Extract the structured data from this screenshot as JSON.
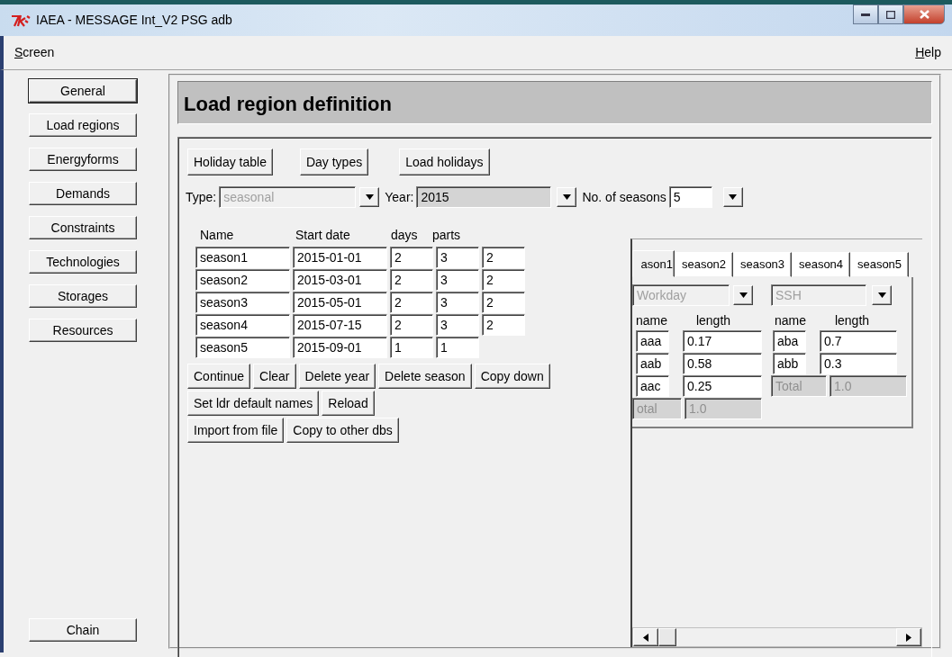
{
  "window": {
    "title": "IAEA - MESSAGE Int_V2 PSG adb"
  },
  "menu": [
    {
      "label": "Screen"
    },
    {
      "label": "Help"
    }
  ],
  "sidebar": {
    "items": [
      {
        "label": "General",
        "focused": true
      },
      {
        "label": "Load regions",
        "focused": false
      },
      {
        "label": "Energyforms",
        "focused": false
      },
      {
        "label": "Demands",
        "focused": false
      },
      {
        "label": "Constraints",
        "focused": false
      },
      {
        "label": "Technologies",
        "focused": false
      },
      {
        "label": "Storages",
        "focused": false
      },
      {
        "label": "Resources",
        "focused": false
      }
    ],
    "bottom_button": {
      "label": "Chain"
    }
  },
  "header": {
    "title": "Load region definition"
  },
  "top_buttons": [
    "Holiday table",
    "Day types",
    "Load holidays"
  ],
  "selectors": [
    {
      "label": "Type:",
      "value": "seasonal",
      "disabled": true,
      "readonly": false
    },
    {
      "label": "Year:",
      "value": "2015",
      "disabled": false,
      "readonly": true
    },
    {
      "label": "No. of seasons",
      "value": "5",
      "disabled": false,
      "readonly": false
    }
  ],
  "seasons_table": {
    "columns": [
      "Name",
      "Start date",
      "days",
      "parts"
    ],
    "rows": [
      [
        "season1",
        "2015-01-01",
        "2",
        "3",
        "2"
      ],
      [
        "season2",
        "2015-03-01",
        "2",
        "3",
        "2"
      ],
      [
        "season3",
        "2015-05-01",
        "2",
        "3",
        "2"
      ],
      [
        "season4",
        "2015-07-15",
        "2",
        "3",
        "2"
      ],
      [
        "season5",
        "2015-09-01",
        "1",
        "1"
      ]
    ]
  },
  "action_buttons": [
    [
      "Continue",
      "Clear",
      "Delete year",
      "Delete season",
      "Copy down"
    ],
    [
      "Set ldr default names",
      "Reload"
    ],
    [
      "Import from file",
      "Copy to other dbs"
    ]
  ],
  "season_tabs": [
    {
      "label": "ason1",
      "selected": true
    },
    {
      "label": "season2",
      "selected": false
    },
    {
      "label": "season3",
      "selected": false
    },
    {
      "label": "season4",
      "selected": false
    },
    {
      "label": "season5",
      "selected": false
    }
  ],
  "day_types": [
    {
      "dropdown": {
        "value": "Workday",
        "disabled": true
      },
      "columns": [
        "name",
        "length"
      ],
      "rows": [
        [
          "aaa",
          "0.17"
        ],
        [
          "aab",
          "0.58"
        ],
        [
          "aac",
          "0.25"
        ]
      ],
      "total": {
        "label": "otal",
        "value": "1.0"
      }
    },
    {
      "dropdown": {
        "value": "SSH",
        "disabled": true
      },
      "columns": [
        "name",
        "length"
      ],
      "rows": [
        [
          "aba",
          "0.7"
        ],
        [
          "abb",
          "0.3"
        ]
      ],
      "total": {
        "label": "Total",
        "value": "1.0"
      }
    }
  ]
}
